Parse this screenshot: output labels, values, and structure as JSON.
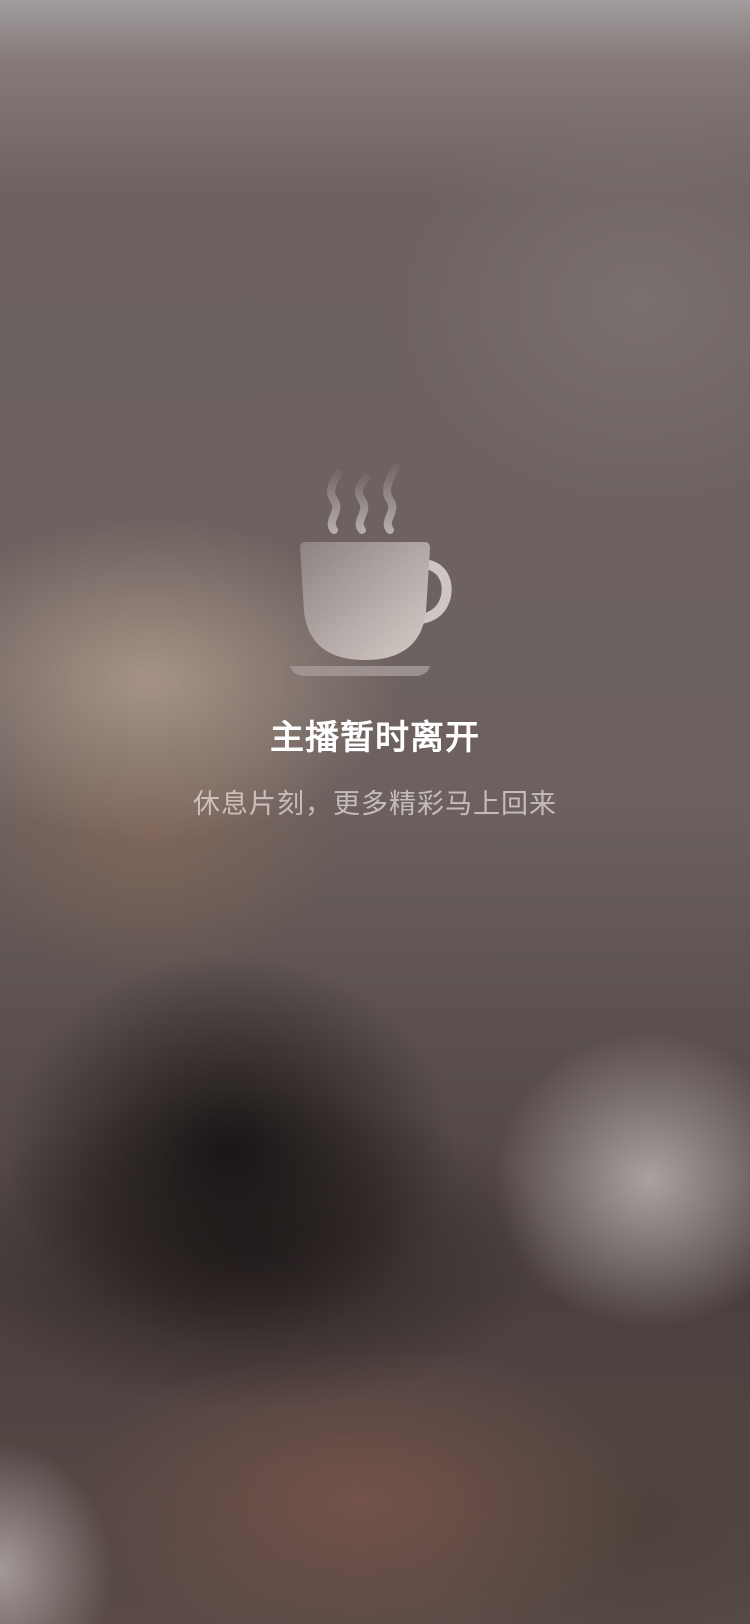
{
  "status": {
    "icon": "coffee-cup-icon",
    "title": "主播暂时离开",
    "subtitle": "休息片刻，更多精彩马上回来"
  },
  "colors": {
    "title": "#ffffff",
    "subtitle": "#d8cfcd",
    "icon": "#cfc6c4"
  }
}
